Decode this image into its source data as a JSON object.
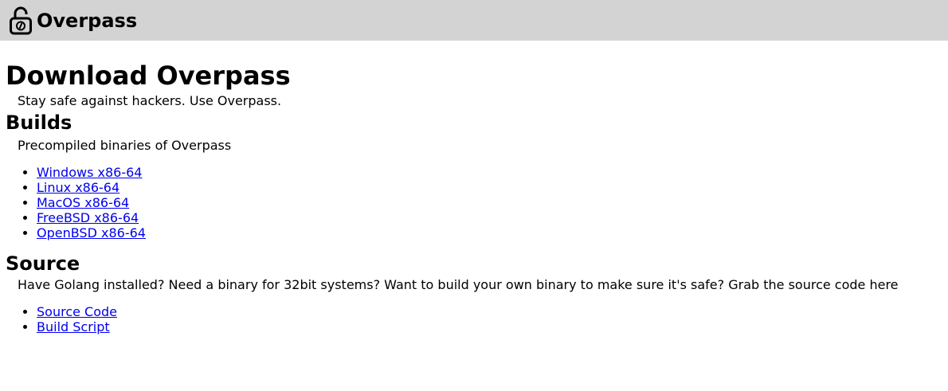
{
  "header": {
    "brand": "Overpass",
    "logo_icon": "unlocked-padlock-icon"
  },
  "main": {
    "title": "Download Overpass",
    "tagline": "Stay safe against hackers. Use Overpass.",
    "builds": {
      "heading": "Builds",
      "description": "Precompiled binaries of Overpass",
      "links": [
        "Windows x86-64",
        "Linux x86-64",
        "MacOS x86-64",
        "FreeBSD x86-64",
        "OpenBSD x86-64"
      ]
    },
    "source": {
      "heading": "Source",
      "description": "Have Golang installed? Need a binary for 32bit systems? Want to build your own binary to make sure it's safe? Grab the source code here",
      "links": [
        "Source Code",
        "Build Script"
      ]
    }
  },
  "colors": {
    "header_bg": "#d3d3d3",
    "link": "#0000ee"
  }
}
